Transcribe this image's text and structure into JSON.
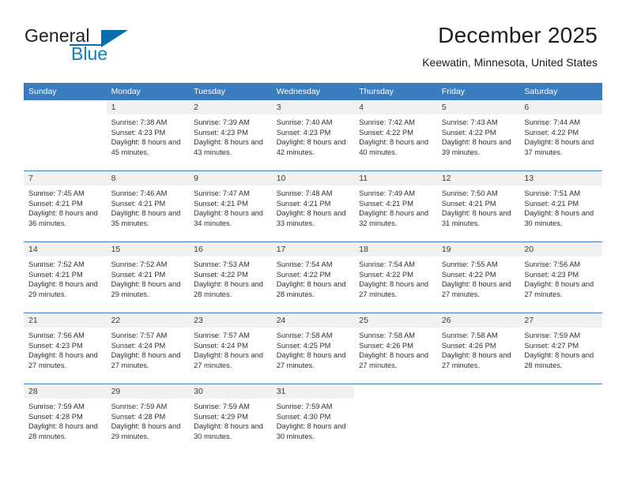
{
  "logo": {
    "word_one": "General",
    "word_two": "Blue",
    "triangle_icon": "triangle-icon",
    "brand_blue": "#0f7fc3",
    "brand_dark_blue": "#0b6cab"
  },
  "header": {
    "month_title": "December 2025",
    "location": "Keewatin, Minnesota, United States",
    "header_bg": "#3b7cbf"
  },
  "weekdays": [
    "Sunday",
    "Monday",
    "Tuesday",
    "Wednesday",
    "Thursday",
    "Friday",
    "Saturday"
  ],
  "labels": {
    "sunrise": "Sunrise:",
    "sunset": "Sunset:",
    "daylight": "Daylight:"
  },
  "weeks": [
    [
      {
        "day": "",
        "empty": true
      },
      {
        "day": "1",
        "sunrise": "Sunrise: 7:38 AM",
        "sunset": "Sunset: 4:23 PM",
        "daylight": "Daylight: 8 hours and 45 minutes."
      },
      {
        "day": "2",
        "sunrise": "Sunrise: 7:39 AM",
        "sunset": "Sunset: 4:23 PM",
        "daylight": "Daylight: 8 hours and 43 minutes."
      },
      {
        "day": "3",
        "sunrise": "Sunrise: 7:40 AM",
        "sunset": "Sunset: 4:23 PM",
        "daylight": "Daylight: 8 hours and 42 minutes."
      },
      {
        "day": "4",
        "sunrise": "Sunrise: 7:42 AM",
        "sunset": "Sunset: 4:22 PM",
        "daylight": "Daylight: 8 hours and 40 minutes."
      },
      {
        "day": "5",
        "sunrise": "Sunrise: 7:43 AM",
        "sunset": "Sunset: 4:22 PM",
        "daylight": "Daylight: 8 hours and 39 minutes."
      },
      {
        "day": "6",
        "sunrise": "Sunrise: 7:44 AM",
        "sunset": "Sunset: 4:22 PM",
        "daylight": "Daylight: 8 hours and 37 minutes."
      }
    ],
    [
      {
        "day": "7",
        "sunrise": "Sunrise: 7:45 AM",
        "sunset": "Sunset: 4:21 PM",
        "daylight": "Daylight: 8 hours and 36 minutes."
      },
      {
        "day": "8",
        "sunrise": "Sunrise: 7:46 AM",
        "sunset": "Sunset: 4:21 PM",
        "daylight": "Daylight: 8 hours and 35 minutes."
      },
      {
        "day": "9",
        "sunrise": "Sunrise: 7:47 AM",
        "sunset": "Sunset: 4:21 PM",
        "daylight": "Daylight: 8 hours and 34 minutes."
      },
      {
        "day": "10",
        "sunrise": "Sunrise: 7:48 AM",
        "sunset": "Sunset: 4:21 PM",
        "daylight": "Daylight: 8 hours and 33 minutes."
      },
      {
        "day": "11",
        "sunrise": "Sunrise: 7:49 AM",
        "sunset": "Sunset: 4:21 PM",
        "daylight": "Daylight: 8 hours and 32 minutes."
      },
      {
        "day": "12",
        "sunrise": "Sunrise: 7:50 AM",
        "sunset": "Sunset: 4:21 PM",
        "daylight": "Daylight: 8 hours and 31 minutes."
      },
      {
        "day": "13",
        "sunrise": "Sunrise: 7:51 AM",
        "sunset": "Sunset: 4:21 PM",
        "daylight": "Daylight: 8 hours and 30 minutes."
      }
    ],
    [
      {
        "day": "14",
        "sunrise": "Sunrise: 7:52 AM",
        "sunset": "Sunset: 4:21 PM",
        "daylight": "Daylight: 8 hours and 29 minutes."
      },
      {
        "day": "15",
        "sunrise": "Sunrise: 7:52 AM",
        "sunset": "Sunset: 4:21 PM",
        "daylight": "Daylight: 8 hours and 29 minutes."
      },
      {
        "day": "16",
        "sunrise": "Sunrise: 7:53 AM",
        "sunset": "Sunset: 4:22 PM",
        "daylight": "Daylight: 8 hours and 28 minutes."
      },
      {
        "day": "17",
        "sunrise": "Sunrise: 7:54 AM",
        "sunset": "Sunset: 4:22 PM",
        "daylight": "Daylight: 8 hours and 28 minutes."
      },
      {
        "day": "18",
        "sunrise": "Sunrise: 7:54 AM",
        "sunset": "Sunset: 4:22 PM",
        "daylight": "Daylight: 8 hours and 27 minutes."
      },
      {
        "day": "19",
        "sunrise": "Sunrise: 7:55 AM",
        "sunset": "Sunset: 4:22 PM",
        "daylight": "Daylight: 8 hours and 27 minutes."
      },
      {
        "day": "20",
        "sunrise": "Sunrise: 7:56 AM",
        "sunset": "Sunset: 4:23 PM",
        "daylight": "Daylight: 8 hours and 27 minutes."
      }
    ],
    [
      {
        "day": "21",
        "sunrise": "Sunrise: 7:56 AM",
        "sunset": "Sunset: 4:23 PM",
        "daylight": "Daylight: 8 hours and 27 minutes."
      },
      {
        "day": "22",
        "sunrise": "Sunrise: 7:57 AM",
        "sunset": "Sunset: 4:24 PM",
        "daylight": "Daylight: 8 hours and 27 minutes."
      },
      {
        "day": "23",
        "sunrise": "Sunrise: 7:57 AM",
        "sunset": "Sunset: 4:24 PM",
        "daylight": "Daylight: 8 hours and 27 minutes."
      },
      {
        "day": "24",
        "sunrise": "Sunrise: 7:58 AM",
        "sunset": "Sunset: 4:25 PM",
        "daylight": "Daylight: 8 hours and 27 minutes."
      },
      {
        "day": "25",
        "sunrise": "Sunrise: 7:58 AM",
        "sunset": "Sunset: 4:26 PM",
        "daylight": "Daylight: 8 hours and 27 minutes."
      },
      {
        "day": "26",
        "sunrise": "Sunrise: 7:58 AM",
        "sunset": "Sunset: 4:26 PM",
        "daylight": "Daylight: 8 hours and 27 minutes."
      },
      {
        "day": "27",
        "sunrise": "Sunrise: 7:59 AM",
        "sunset": "Sunset: 4:27 PM",
        "daylight": "Daylight: 8 hours and 28 minutes."
      }
    ],
    [
      {
        "day": "28",
        "sunrise": "Sunrise: 7:59 AM",
        "sunset": "Sunset: 4:28 PM",
        "daylight": "Daylight: 8 hours and 28 minutes."
      },
      {
        "day": "29",
        "sunrise": "Sunrise: 7:59 AM",
        "sunset": "Sunset: 4:28 PM",
        "daylight": "Daylight: 8 hours and 29 minutes."
      },
      {
        "day": "30",
        "sunrise": "Sunrise: 7:59 AM",
        "sunset": "Sunset: 4:29 PM",
        "daylight": "Daylight: 8 hours and 30 minutes."
      },
      {
        "day": "31",
        "sunrise": "Sunrise: 7:59 AM",
        "sunset": "Sunset: 4:30 PM",
        "daylight": "Daylight: 8 hours and 30 minutes."
      },
      {
        "day": "",
        "empty": true
      },
      {
        "day": "",
        "empty": true
      },
      {
        "day": "",
        "empty": true
      }
    ]
  ]
}
